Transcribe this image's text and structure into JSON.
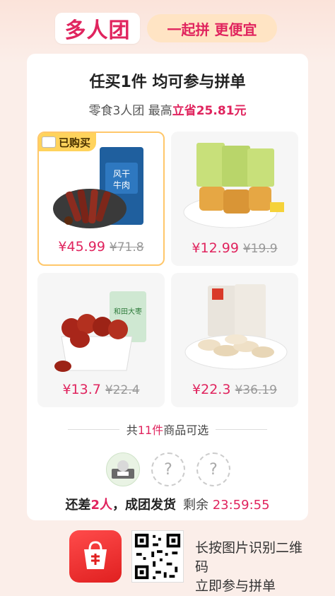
{
  "header": {
    "brand": "多人团",
    "slogan": "一起拼 更便宜"
  },
  "headline": "任买1件 均可参与拼单",
  "subline": {
    "prefix": "零食3人团 最高",
    "highlight": "立省25.81元"
  },
  "bought_tag": "已购买",
  "products": [
    {
      "price": "¥45.99",
      "original": "¥71.8",
      "bought": true,
      "name": "风干牛肉"
    },
    {
      "price": "¥12.99",
      "original": "¥19.9",
      "bought": false,
      "name": ""
    },
    {
      "price": "¥13.7",
      "original": "¥22.4",
      "bought": false,
      "name": "和田大枣"
    },
    {
      "price": "¥22.3",
      "original": "¥36.19",
      "bought": false,
      "name": ""
    }
  ],
  "total": {
    "prefix": "共",
    "count": "11件",
    "suffix": "商品可选"
  },
  "slots": {
    "filled": 1,
    "empty": 2,
    "empty_glyph": "?"
  },
  "status": {
    "prefix": "还差",
    "count": "2人",
    "suffix": "，成团发货",
    "remaining_label": "剩余",
    "timer": "23:59:55"
  },
  "footer": {
    "scan_line1": "长按图片识别二维",
    "scan_line2": "码",
    "scan_line3": "立即参与拼单"
  },
  "colors": {
    "accent": "#e0245e",
    "background": "#fbeee9",
    "tag": "#ffd35c"
  }
}
